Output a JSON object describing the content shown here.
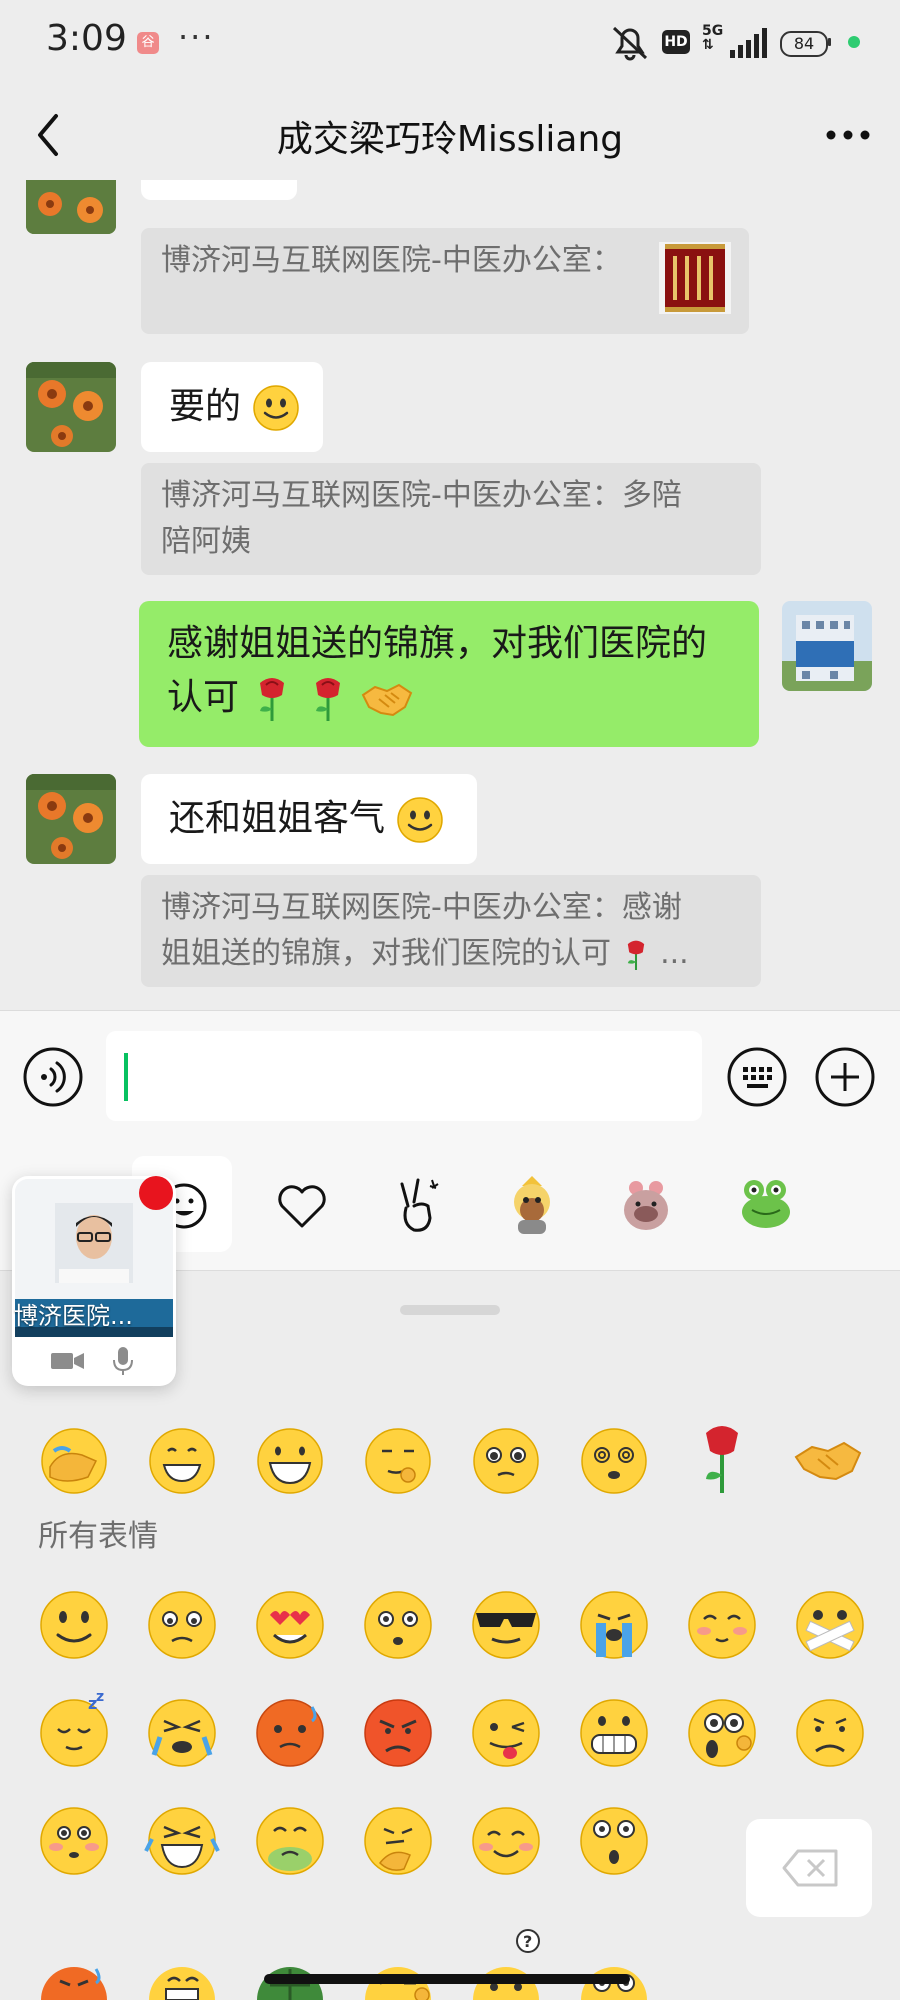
{
  "status": {
    "time": "3:09",
    "app_badge": "谷",
    "more": "···",
    "hd": "HD",
    "net_top": "5G",
    "net_bottom": "⇅",
    "battery": "84"
  },
  "nav": {
    "title": "成交梁巧玲Missliang"
  },
  "messages": [
    {
      "quote": "博济河马互联网医院-中医办公室："
    },
    {
      "text": "要的",
      "quote_line1": "博济河马互联网医院-中医办公室：多陪",
      "quote_line2": "陪阿姨"
    },
    {
      "text_line1": "感谢姐姐送的锦旗，对我们医院的",
      "text_line2": "认可"
    },
    {
      "text": "还和姐姐客气",
      "quote_line1": "博济河马互联网医院-中医办公室：感谢",
      "quote_line2": "姐姐送的锦旗，对我们医院的认可",
      "quote_ellipsis": " ..."
    }
  ],
  "input": {
    "value": ""
  },
  "emoji_panel": {
    "section_label": "所有表情"
  },
  "video_call": {
    "name": "博济医院..."
  },
  "colors": {
    "green_bubble": "#95ec69",
    "accent": "#07c160",
    "badge_red": "#e8141e"
  }
}
